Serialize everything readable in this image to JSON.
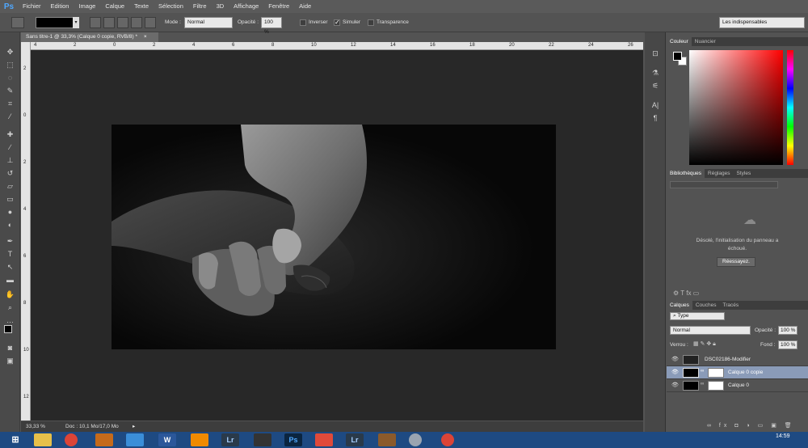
{
  "app": {
    "logo": "Ps"
  },
  "menu": [
    "Fichier",
    "Edition",
    "Image",
    "Calque",
    "Texte",
    "Sélection",
    "Filtre",
    "3D",
    "Affichage",
    "Fenêtre",
    "Aide"
  ],
  "options": {
    "mode_label": "Mode :",
    "mode_value": "Normal",
    "opacity_label": "Opacité :",
    "opacity_value": "100 %",
    "invert_label": "Inverser",
    "simulate_label": "Simuler",
    "transparency_label": "Transparence",
    "workspace": "Les indispensables"
  },
  "document": {
    "tab_title": "Sans titre-1 @ 33,3% (Calque 0 copie, RVB/8) *",
    "zoom": "33,33 %",
    "doc_info": "Doc : 10,1 Mo/17,0 Mo",
    "ruler_h": [
      "4",
      "2",
      "0",
      "2",
      "4",
      "6",
      "8",
      "10",
      "12",
      "14",
      "16",
      "18",
      "20",
      "22",
      "24",
      "26"
    ],
    "ruler_v": [
      "2",
      "0",
      "2",
      "4",
      "6",
      "8",
      "10",
      "12"
    ]
  },
  "color_panel": {
    "tabs": [
      "Couleur",
      "Nuancier"
    ],
    "foreground": "#000000",
    "background": "#ffffff",
    "hue": "#ff0000"
  },
  "library_panel": {
    "tabs": [
      "Bibliothèques",
      "Réglages",
      "Styles"
    ],
    "error_message": "Désolé, l'initialisation du panneau a échoué.",
    "retry_button": "Réessayez."
  },
  "layers_panel": {
    "tabs": [
      "Calques",
      "Couches",
      "Tracés"
    ],
    "filter": "Type",
    "blend_mode": "Normal",
    "opacity_label": "Opacité :",
    "opacity_value": "100 %",
    "lock_label": "Verrou :",
    "fill_label": "Fond :",
    "fill_value": "100 %",
    "layers": [
      {
        "name": "DSC02186-Modifier",
        "selected": false
      },
      {
        "name": "Calque 0 copie",
        "selected": true
      },
      {
        "name": "Calque 0",
        "selected": false
      }
    ]
  },
  "taskbar": {
    "apps": [
      "Explorer",
      "Chrome",
      "App",
      "Files",
      "Word",
      "VLC",
      "Lightroom",
      "Inkscape",
      "Photoshop",
      "Media",
      "Lightroom",
      "Game",
      "Search",
      "Chrome"
    ],
    "clock": "14:59"
  }
}
